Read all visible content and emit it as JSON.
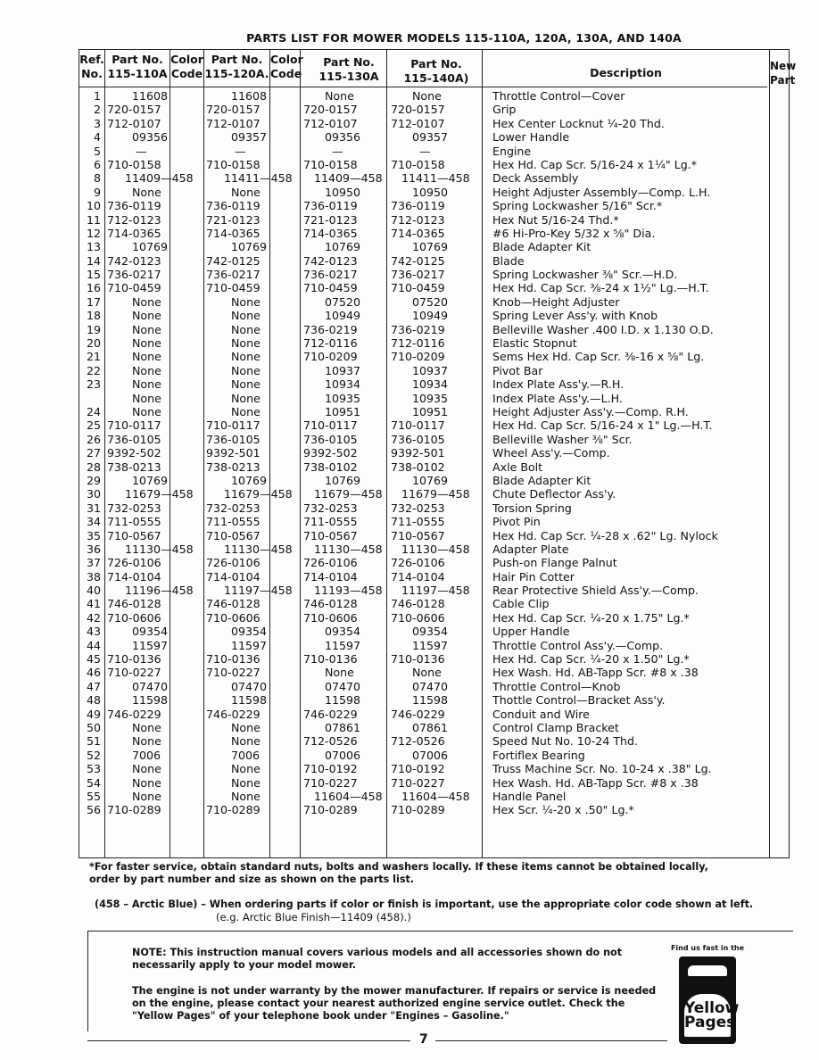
{
  "title": "PARTS LIST FOR MOWER MODELS 115-110A, 120A, 130A, AND 140A",
  "headers": {
    "ref": "Ref. No.",
    "p110": "Part No. 115-110A",
    "color1": "Color Code",
    "p120": "Part No. 115-120A.",
    "color2": "Color Code",
    "p130": "Part No. 115-130A",
    "p140": "Part No. 115-140A)",
    "desc": "Description",
    "new": "New Part"
  },
  "rows": [
    [
      "1",
      "11608",
      "11608",
      "None",
      "None",
      "Throttle Control—Cover"
    ],
    [
      "2",
      "720-0157",
      "720-0157",
      "720-0157",
      "720-0157",
      "Grip"
    ],
    [
      "3",
      "712-0107",
      "712-0107",
      "712-0107",
      "712-0107",
      "Hex Center Locknut ¼-20 Thd."
    ],
    [
      "4",
      "09356",
      "09357",
      "09356",
      "09357",
      "Lower Handle"
    ],
    [
      "5",
      "—",
      "—",
      "—",
      "—",
      "Engine"
    ],
    [
      "6",
      "710-0158",
      "710-0158",
      "710-0158",
      "710-0158",
      "Hex Hd. Cap Scr. 5/16-24 x 1¼\" Lg.*"
    ],
    [
      "8",
      "11409—458",
      "11411—458",
      "11409—458",
      "11411—458",
      "Deck Assembly"
    ],
    [
      "9",
      "None",
      "None",
      "10950",
      "10950",
      "Height Adjuster Assembly—Comp. L.H."
    ],
    [
      "10",
      "736-0119",
      "736-0119",
      "736-0119",
      "736-0119",
      "Spring Lockwasher 5/16\" Scr.*"
    ],
    [
      "11",
      "712-0123",
      "721-0123",
      "721-0123",
      "712-0123",
      "Hex Nut 5/16-24 Thd.*"
    ],
    [
      "12",
      "714-0365",
      "714-0365",
      "714-0365",
      "714-0365",
      "#6 Hi-Pro-Key 5/32 x ⅝\" Dia."
    ],
    [
      "13",
      "10769",
      "10769",
      "10769",
      "10769",
      "Blade Adapter Kit"
    ],
    [
      "14",
      "742-0123",
      "742-0125",
      "742-0123",
      "742-0125",
      "Blade"
    ],
    [
      "15",
      "736-0217",
      "736-0217",
      "736-0217",
      "736-0217",
      "Spring Lockwasher ⅜\" Scr.—H.D."
    ],
    [
      "16",
      "710-0459",
      "710-0459",
      "710-0459",
      "710-0459",
      "Hex Hd. Cap Scr. ⅜-24 x 1½\" Lg.—H.T."
    ],
    [
      "17",
      "None",
      "None",
      "07520",
      "07520",
      "Knob—Height Adjuster"
    ],
    [
      "18",
      "None",
      "None",
      "10949",
      "10949",
      "Spring Lever Ass'y. with Knob"
    ],
    [
      "19",
      "None",
      "None",
      "736-0219",
      "736-0219",
      "Belleville Washer .400 I.D. x 1.130 O.D."
    ],
    [
      "20",
      "None",
      "None",
      "712-0116",
      "712-0116",
      "Elastic Stopnut"
    ],
    [
      "21",
      "None",
      "None",
      "710-0209",
      "710-0209",
      "Sems Hex Hd. Cap Scr. ⅜-16 x ⅝\" Lg."
    ],
    [
      "22",
      "None",
      "None",
      "10937",
      "10937",
      "Pivot Bar"
    ],
    [
      "23",
      "None",
      "None",
      "10934",
      "10934",
      "Index Plate Ass'y.—R.H."
    ],
    [
      "",
      "None",
      "None",
      "10935",
      "10935",
      "Index Plate Ass'y.—L.H."
    ],
    [
      "24",
      "None",
      "None",
      "10951",
      "10951",
      "Height Adjuster Ass'y.—Comp. R.H."
    ],
    [
      "25",
      "710-0117",
      "710-0117",
      "710-0117",
      "710-0117",
      "Hex Hd. Cap Scr. 5/16-24 x 1\" Lg.—H.T."
    ],
    [
      "26",
      "736-0105",
      "736-0105",
      "736-0105",
      "736-0105",
      "Belleville Washer ⅜\" Scr."
    ],
    [
      "27",
      "9392-502",
      "9392-501",
      "9392-502",
      "9392-501",
      "Wheel Ass'y.—Comp."
    ],
    [
      "28",
      "738-0213",
      "738-0213",
      "738-0102",
      "738-0102",
      "Axle Bolt"
    ],
    [
      "29",
      "10769",
      "10769",
      "10769",
      "10769",
      "Blade Adapter Kit"
    ],
    [
      "30",
      "11679—458",
      "11679—458",
      "11679—458",
      "11679—458",
      "Chute Deflector Ass'y."
    ],
    [
      "31",
      "732-0253",
      "732-0253",
      "732-0253",
      "732-0253",
      "Torsion Spring"
    ],
    [
      "34",
      "711-0555",
      "711-0555",
      "711-0555",
      "711-0555",
      "Pivot Pin"
    ],
    [
      "35",
      "710-0567",
      "710-0567",
      "710-0567",
      "710-0567",
      "Hex Hd. Cap Scr. ¼-28 x .62\" Lg. Nylock"
    ],
    [
      "36",
      "11130—458",
      "11130—458",
      "11130—458",
      "11130—458",
      "Adapter Plate"
    ],
    [
      "37",
      "726-0106",
      "726-0106",
      "726-0106",
      "726-0106",
      "Push-on Flange Palnut"
    ],
    [
      "38",
      "714-0104",
      "714-0104",
      "714-0104",
      "714-0104",
      "Hair Pin Cotter"
    ],
    [
      "40",
      "11196—458",
      "11197—458",
      "11193—458",
      "11197—458",
      "Rear Protective Shield Ass'y.—Comp."
    ],
    [
      "41",
      "746-0128",
      "746-0128",
      "746-0128",
      "746-0128",
      "Cable Clip"
    ],
    [
      "42",
      "710-0606",
      "710-0606",
      "710-0606",
      "710-0606",
      "Hex Hd. Cap Scr. ¼-20 x 1.75\" Lg.*"
    ],
    [
      "43",
      "09354",
      "09354",
      "09354",
      "09354",
      "Upper Handle"
    ],
    [
      "44",
      "11597",
      "11597",
      "11597",
      "11597",
      "Throttle Control Ass'y.—Comp."
    ],
    [
      "45",
      "710-0136",
      "710-0136",
      "710-0136",
      "710-0136",
      "Hex Hd. Cap Scr. ¼-20 x 1.50\" Lg.*"
    ],
    [
      "46",
      "710-0227",
      "710-0227",
      "None",
      "None",
      "Hex Wash. Hd. AB-Tapp Scr. #8 x .38"
    ],
    [
      "47",
      "07470",
      "07470",
      "07470",
      "07470",
      "Throttle Control—Knob"
    ],
    [
      "48",
      "11598",
      "11598",
      "11598",
      "11598",
      "Thottle Control—Bracket Ass'y."
    ],
    [
      "49",
      "746-0229",
      "746-0229",
      "746-0229",
      "746-0229",
      "Conduit and Wire"
    ],
    [
      "50",
      "None",
      "None",
      "07861",
      "07861",
      "Control Clamp Bracket"
    ],
    [
      "51",
      "None",
      "None",
      "712-0526",
      "712-0526",
      "Speed Nut No. 10-24 Thd."
    ],
    [
      "52",
      "7006",
      "7006",
      "07006",
      "07006",
      "Fortiflex Bearing"
    ],
    [
      "53",
      "None",
      "None",
      "710-0192",
      "710-0192",
      "Truss Machine Scr. No. 10-24 x .38\" Lg."
    ],
    [
      "54",
      "None",
      "None",
      "710-0227",
      "710-0227",
      "Hex Wash. Hd. AB-Tapp Scr. #8 x .38"
    ],
    [
      "55",
      "None",
      "None",
      "11604—458",
      "11604—458",
      "Handle Panel"
    ],
    [
      "56",
      "710-0289",
      "710-0289",
      "710-0289",
      "710-0289",
      "Hex Scr. ¼-20 x .50\" Lg.*"
    ]
  ],
  "footnote": "*For faster service, obtain standard nuts, bolts and washers locally. If these items cannot be obtained locally, order by part number and size as shown on the parts list.",
  "color_note": "(458 – Arctic Blue) – When ordering parts if color or finish is important, use the appropriate color code shown at left.",
  "color_example": "(e.g. Arctic Blue Finish—11409 (458).)",
  "note_label": "NOTE:",
  "note_text": "This instruction manual covers various models and all accessories shown do not necessarily apply to your model mower.",
  "engine_text": "The engine is not under warranty by the mower manufacturer. If repairs or service is needed on the engine, please contact your nearest authorized engine service outlet. Check the \"Yellow Pages\" of your telephone book under \"Engines – Gasoline.\"",
  "yellow_pages": {
    "tagline": "Find us fast in the",
    "logo_line1": "Yellow",
    "logo_line2": "Pages"
  },
  "page_number": "7"
}
